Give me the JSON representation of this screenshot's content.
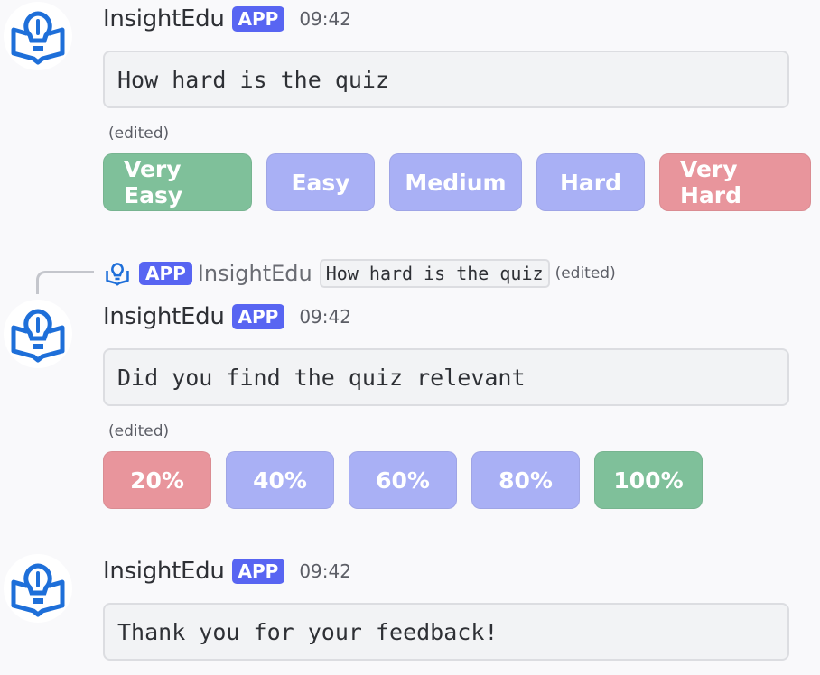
{
  "colors": {
    "app_tag": "#5865f2",
    "button_green": "#7fc09a",
    "button_blue": "#a9b0f5",
    "button_red": "#e8959c",
    "logo_blue": "#1e6fd9"
  },
  "messages": [
    {
      "username": "InsightEdu",
      "app_tag": "APP",
      "time": "09:42",
      "text": "How hard is the quiz",
      "edited": "(edited)",
      "buttons": [
        {
          "label": "Very Easy",
          "color": "green"
        },
        {
          "label": "Easy",
          "color": "blue"
        },
        {
          "label": "Medium",
          "color": "blue"
        },
        {
          "label": "Hard",
          "color": "blue"
        },
        {
          "label": "Very Hard",
          "color": "red"
        }
      ]
    },
    {
      "reply": {
        "app_tag": "APP",
        "username": "InsightEdu",
        "text": "How hard is the quiz",
        "edited": "(edited)"
      },
      "username": "InsightEdu",
      "app_tag": "APP",
      "time": "09:42",
      "text": "Did you find the quiz relevant",
      "edited": "(edited)",
      "buttons": [
        {
          "label": "20%",
          "color": "red"
        },
        {
          "label": "40%",
          "color": "blue"
        },
        {
          "label": "60%",
          "color": "blue"
        },
        {
          "label": "80%",
          "color": "blue"
        },
        {
          "label": "100%",
          "color": "green"
        }
      ]
    },
    {
      "username": "InsightEdu",
      "app_tag": "APP",
      "time": "09:42",
      "text": "Thank you for your feedback!"
    }
  ]
}
